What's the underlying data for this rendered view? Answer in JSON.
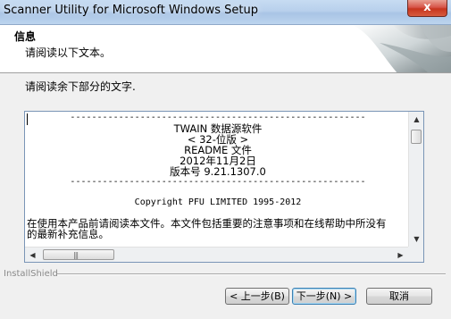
{
  "window": {
    "title": "Scanner Utility for Microsoft Windows Setup",
    "close_glyph": "x"
  },
  "header": {
    "title": "信息",
    "subtitle": "请阅读以下文本。"
  },
  "instruction": "请阅读余下部分的文字.",
  "readme": {
    "lines": [
      "-------------------------------------------------------",
      "TWAIN 数据源软件",
      "< 32-位版 >",
      "README 文件",
      "2012年11月2日",
      "版本号 9.21.1307.0",
      "-------------------------------------------------------",
      "",
      "Copyright PFU LIMITED 1995-2012",
      "在使用本产品前请阅读本文件。本文件包括重要的注意事项和在线帮助中所没有",
      "的最新补充信息。"
    ]
  },
  "scrollbar": {
    "up": "▲",
    "down": "▼",
    "left": "◀",
    "right": "▶",
    "grip": "|||"
  },
  "footer": {
    "brand": "InstallShield",
    "back_label": "< 上一步(B)",
    "next_label": "下一步(N) >",
    "cancel_label": "取消"
  },
  "colors": {
    "accent": "#3c7fb1",
    "close": "#c7351e"
  }
}
